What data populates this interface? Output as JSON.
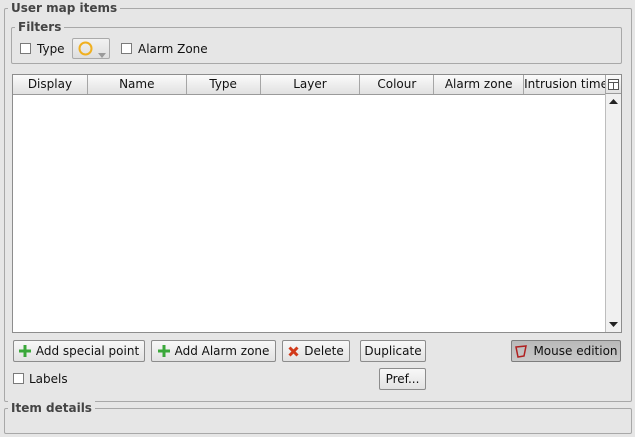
{
  "user_map_items": {
    "title": "User map items",
    "filters": {
      "title": "Filters",
      "type_label": "Type",
      "alarm_zone_label": "Alarm Zone",
      "type_combo_icon": "circle-icon"
    },
    "table": {
      "columns": [
        "Display",
        "Name",
        "Type",
        "Layer",
        "Colour",
        "Alarm zone",
        "Intrusion time"
      ]
    },
    "buttons": {
      "add_special_point": "Add special point",
      "add_alarm_zone": "Add Alarm zone",
      "delete": "Delete",
      "duplicate": "Duplicate",
      "mouse_edition": "Mouse edition",
      "pref": "Pref..."
    },
    "labels_checkbox": "Labels"
  },
  "item_details": {
    "title": "Item details"
  },
  "colors": {
    "add_icon": "#3aa83a",
    "delete_icon": "#d23a1a",
    "combo_circle": "#f0b020",
    "mouse_icon": "#b02020"
  }
}
